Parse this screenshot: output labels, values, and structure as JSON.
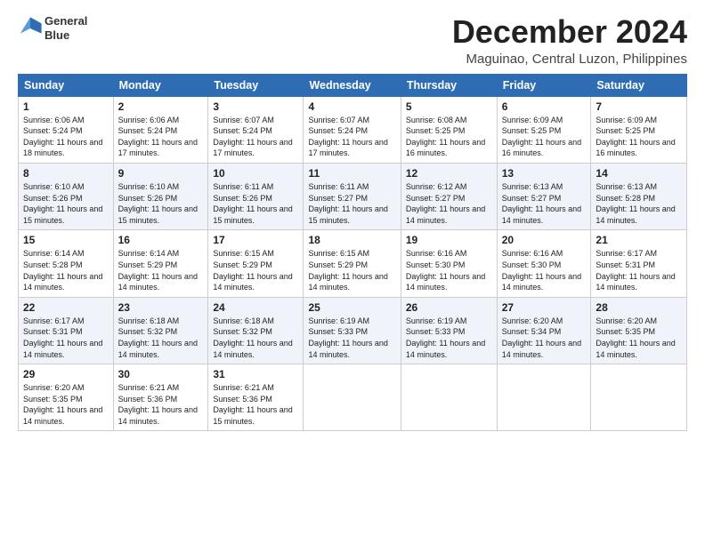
{
  "logo": {
    "line1": "General",
    "line2": "Blue"
  },
  "title": "December 2024",
  "subtitle": "Maguinao, Central Luzon, Philippines",
  "headers": [
    "Sunday",
    "Monday",
    "Tuesday",
    "Wednesday",
    "Thursday",
    "Friday",
    "Saturday"
  ],
  "weeks": [
    [
      {
        "day": "1",
        "sunrise": "6:06 AM",
        "sunset": "5:24 PM",
        "daylight": "11 hours and 18 minutes."
      },
      {
        "day": "2",
        "sunrise": "6:06 AM",
        "sunset": "5:24 PM",
        "daylight": "11 hours and 17 minutes."
      },
      {
        "day": "3",
        "sunrise": "6:07 AM",
        "sunset": "5:24 PM",
        "daylight": "11 hours and 17 minutes."
      },
      {
        "day": "4",
        "sunrise": "6:07 AM",
        "sunset": "5:24 PM",
        "daylight": "11 hours and 17 minutes."
      },
      {
        "day": "5",
        "sunrise": "6:08 AM",
        "sunset": "5:25 PM",
        "daylight": "11 hours and 16 minutes."
      },
      {
        "day": "6",
        "sunrise": "6:09 AM",
        "sunset": "5:25 PM",
        "daylight": "11 hours and 16 minutes."
      },
      {
        "day": "7",
        "sunrise": "6:09 AM",
        "sunset": "5:25 PM",
        "daylight": "11 hours and 16 minutes."
      }
    ],
    [
      {
        "day": "8",
        "sunrise": "6:10 AM",
        "sunset": "5:26 PM",
        "daylight": "11 hours and 15 minutes."
      },
      {
        "day": "9",
        "sunrise": "6:10 AM",
        "sunset": "5:26 PM",
        "daylight": "11 hours and 15 minutes."
      },
      {
        "day": "10",
        "sunrise": "6:11 AM",
        "sunset": "5:26 PM",
        "daylight": "11 hours and 15 minutes."
      },
      {
        "day": "11",
        "sunrise": "6:11 AM",
        "sunset": "5:27 PM",
        "daylight": "11 hours and 15 minutes."
      },
      {
        "day": "12",
        "sunrise": "6:12 AM",
        "sunset": "5:27 PM",
        "daylight": "11 hours and 14 minutes."
      },
      {
        "day": "13",
        "sunrise": "6:13 AM",
        "sunset": "5:27 PM",
        "daylight": "11 hours and 14 minutes."
      },
      {
        "day": "14",
        "sunrise": "6:13 AM",
        "sunset": "5:28 PM",
        "daylight": "11 hours and 14 minutes."
      }
    ],
    [
      {
        "day": "15",
        "sunrise": "6:14 AM",
        "sunset": "5:28 PM",
        "daylight": "11 hours and 14 minutes."
      },
      {
        "day": "16",
        "sunrise": "6:14 AM",
        "sunset": "5:29 PM",
        "daylight": "11 hours and 14 minutes."
      },
      {
        "day": "17",
        "sunrise": "6:15 AM",
        "sunset": "5:29 PM",
        "daylight": "11 hours and 14 minutes."
      },
      {
        "day": "18",
        "sunrise": "6:15 AM",
        "sunset": "5:29 PM",
        "daylight": "11 hours and 14 minutes."
      },
      {
        "day": "19",
        "sunrise": "6:16 AM",
        "sunset": "5:30 PM",
        "daylight": "11 hours and 14 minutes."
      },
      {
        "day": "20",
        "sunrise": "6:16 AM",
        "sunset": "5:30 PM",
        "daylight": "11 hours and 14 minutes."
      },
      {
        "day": "21",
        "sunrise": "6:17 AM",
        "sunset": "5:31 PM",
        "daylight": "11 hours and 14 minutes."
      }
    ],
    [
      {
        "day": "22",
        "sunrise": "6:17 AM",
        "sunset": "5:31 PM",
        "daylight": "11 hours and 14 minutes."
      },
      {
        "day": "23",
        "sunrise": "6:18 AM",
        "sunset": "5:32 PM",
        "daylight": "11 hours and 14 minutes."
      },
      {
        "day": "24",
        "sunrise": "6:18 AM",
        "sunset": "5:32 PM",
        "daylight": "11 hours and 14 minutes."
      },
      {
        "day": "25",
        "sunrise": "6:19 AM",
        "sunset": "5:33 PM",
        "daylight": "11 hours and 14 minutes."
      },
      {
        "day": "26",
        "sunrise": "6:19 AM",
        "sunset": "5:33 PM",
        "daylight": "11 hours and 14 minutes."
      },
      {
        "day": "27",
        "sunrise": "6:20 AM",
        "sunset": "5:34 PM",
        "daylight": "11 hours and 14 minutes."
      },
      {
        "day": "28",
        "sunrise": "6:20 AM",
        "sunset": "5:35 PM",
        "daylight": "11 hours and 14 minutes."
      }
    ],
    [
      {
        "day": "29",
        "sunrise": "6:20 AM",
        "sunset": "5:35 PM",
        "daylight": "11 hours and 14 minutes."
      },
      {
        "day": "30",
        "sunrise": "6:21 AM",
        "sunset": "5:36 PM",
        "daylight": "11 hours and 14 minutes."
      },
      {
        "day": "31",
        "sunrise": "6:21 AM",
        "sunset": "5:36 PM",
        "daylight": "11 hours and 15 minutes."
      },
      null,
      null,
      null,
      null
    ]
  ],
  "labels": {
    "sunrise": "Sunrise:",
    "sunset": "Sunset:",
    "daylight": "Daylight:"
  }
}
